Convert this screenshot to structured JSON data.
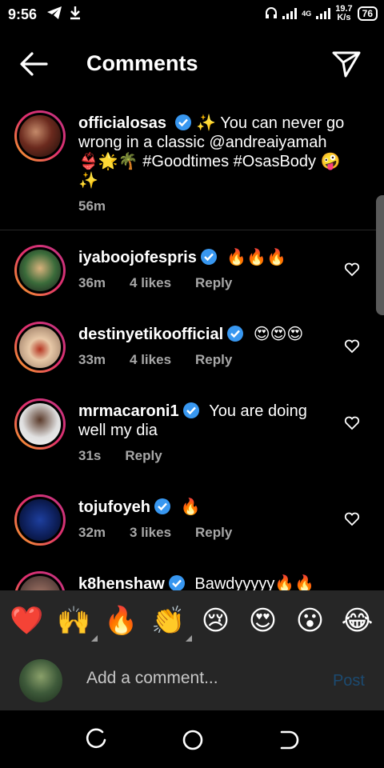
{
  "status_bar": {
    "time": "9:56",
    "network_label": "4G",
    "speed_value": "19.7",
    "speed_unit": "K/s",
    "battery": "76"
  },
  "header": {
    "title": "Comments"
  },
  "caption": {
    "username": "officialosas",
    "text": " ✨ You can never go wrong in a classic @andreaiyamah 👙🌟🌴 #Goodtimes #OsasBody 🤪✨",
    "time": "56m"
  },
  "comments": [
    {
      "username": "iyaboojofespris",
      "text": "🔥🔥🔥",
      "time": "36m",
      "likes": "4 likes",
      "reply": "Reply"
    },
    {
      "username": "destinyetikoofficial",
      "text": "😍😍😍",
      "time": "33m",
      "likes": "4 likes",
      "reply": "Reply"
    },
    {
      "username": "mrmacaroni1",
      "text": "You are doing well my dia",
      "time": "31s",
      "likes": "",
      "reply": "Reply"
    },
    {
      "username": "tojufoyeh",
      "text": "🔥",
      "time": "32m",
      "likes": "3 likes",
      "reply": "Reply"
    },
    {
      "username": "k8henshaw",
      "text": "Bawdyyyyy🔥🔥",
      "time": "",
      "likes": "",
      "reply": ""
    }
  ],
  "emoji_bar": [
    "❤️",
    "🙌",
    "🔥",
    "👏",
    "😢",
    "😍",
    "😮",
    "😂"
  ],
  "add_comment": {
    "placeholder": "Add a comment...",
    "post_label": "Post"
  },
  "colors": {
    "verified": "#3897f0",
    "secondary_text": "#a8a8a8",
    "post_disabled": "#1c4a70",
    "panel_bg": "#262626"
  }
}
